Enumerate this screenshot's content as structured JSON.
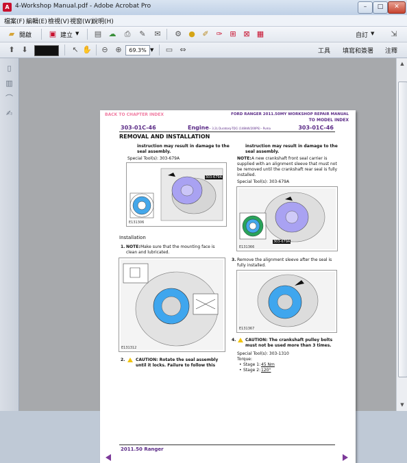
{
  "window": {
    "title": "4-Workshop Manual.pdf - Adobe Acrobat Pro"
  },
  "menu": [
    "檔案(F)",
    "編輯(E)",
    "檢視(V)",
    "視窗(W)",
    "說明(H)"
  ],
  "toolbar": {
    "open_label": "開啟",
    "create_label": "建立",
    "customize_label": "自訂"
  },
  "nav": {
    "zoom_value": "69.3%"
  },
  "panels": {
    "tools": "工具",
    "fill_sign": "填寫和簽署",
    "comments": "注釋"
  },
  "doc": {
    "back_link": "BACK TO CHAPTER INDEX",
    "manual_title": "FORD RANGER 2011.50MY WORKSHOP REPAIR MANUAL",
    "model_link": "TO MODEL INDEX",
    "section_code": "303-01C-46",
    "section_title": "Engine",
    "section_sub": "— 3.2L Duratorq-TDCi (148kW/200PS) - Puma",
    "section_code_right": "303-01C-46",
    "procedure": "REMOVAL AND INSTALLATION",
    "left": {
      "intro_line1": "instruction may result in damage to the",
      "intro_line2": "seal assembly.",
      "special_tool": "Special Tool(s): 303-679A",
      "fig1_label": "303-679A",
      "fig1_code": "E131306",
      "installation": "Installation",
      "step1_num": "1.",
      "step1_note": "NOTE:",
      "step1_text1": "Make sure that the mounting face is",
      "step1_text2": "clean and lubricated.",
      "fig2_code": "E131312",
      "step2_num": "2.",
      "step2_caution": "CAUTION: Rotate the seal assembly",
      "step2_text": "until it locks. Failure to follow this"
    },
    "right": {
      "intro_line1": "instruction may result in damage to the",
      "intro_line2": "seal assembly.",
      "note_label": "NOTE:",
      "note_line1": "A new crankshaft front seal carrier is",
      "note_line2": "supplied with an alignment sleeve that must not",
      "note_line3": "be removed until the crankshaft rear seal is fully",
      "note_line4": "installed.",
      "special_tool": "Special Tool(s): 303-679A",
      "fig3_label": "303-679A",
      "fig3_code": "E131366",
      "step3_num": "3.",
      "step3_line1": "Remove the alignment sleeve after the seal is",
      "step3_line2": "fully installed.",
      "fig4_code": "E131367",
      "step4_num": "4.",
      "step4_caution1": "CAUTION: The crankshaft pulley bolts",
      "step4_caution2": "must not be used more than 3 times.",
      "special_tool2": "Special Tool(s): 303-1310",
      "torque": "Torque:",
      "stage1_label": "Stage 1:",
      "stage1_value": "45 Nm",
      "stage2_label": "Stage 2:",
      "stage2_value": "120°"
    },
    "footer": "2011.50 Ranger"
  }
}
